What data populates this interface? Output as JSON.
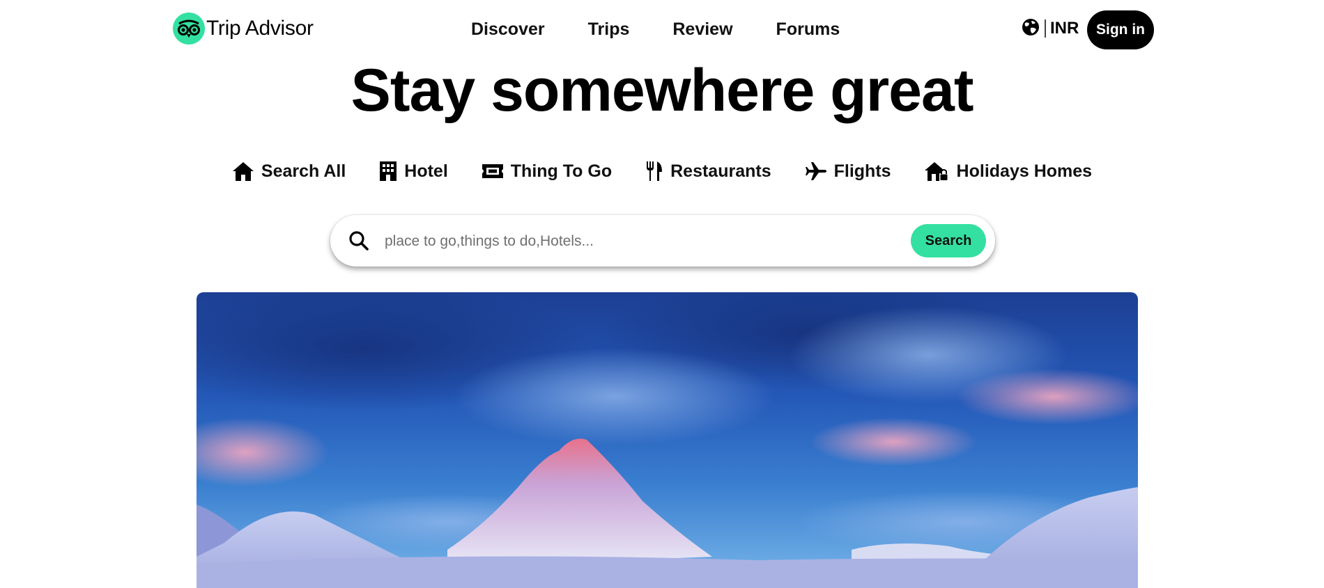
{
  "brand": {
    "name": "Trip Advisor",
    "accent_color": "#34e0a1",
    "logo_icon": "owl-eyes-icon"
  },
  "nav": {
    "links": [
      "Discover",
      "Trips",
      "Review",
      "Forums"
    ],
    "currency_icon": "globe-icon",
    "currency_label": "INR",
    "signin_label": "Sign in"
  },
  "hero": {
    "title": "Stay somewhere great"
  },
  "categories": [
    {
      "label": "Search All",
      "icon": "home-icon"
    },
    {
      "label": "Hotel",
      "icon": "hotel-building-icon"
    },
    {
      "label": "Thing To Go",
      "icon": "ticket-icon"
    },
    {
      "label": "Restaurants",
      "icon": "fork-knife-icon"
    },
    {
      "label": "Flights",
      "icon": "airplane-icon"
    },
    {
      "label": "Holidays Homes",
      "icon": "house-lock-icon"
    }
  ],
  "search": {
    "placeholder": "place to go,things to do,Hotels...",
    "value": "",
    "button_label": "Search",
    "icon": "search-icon"
  },
  "banner": {
    "image_icon": "snowy-mountain-landscape-image"
  }
}
